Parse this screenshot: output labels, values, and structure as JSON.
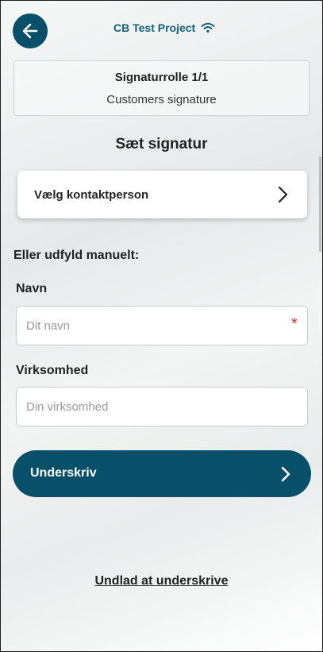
{
  "header": {
    "project_title": "CB Test Project",
    "back_icon": "arrow-left-icon",
    "status_icon": "wifi-icon"
  },
  "role": {
    "title": "Signaturrolle 1/1",
    "subtitle": "Customers signature"
  },
  "section_title": "Sæt signatur",
  "contact": {
    "label": "Vælg kontaktperson",
    "icon": "chevron-right-icon"
  },
  "manual_label": "Eller udfyld manuelt:",
  "form": {
    "name": {
      "label": "Navn",
      "placeholder": "Dit navn",
      "value": "",
      "required_marker": "*"
    },
    "company": {
      "label": "Virksomhed",
      "placeholder": "Din virksomhed",
      "value": ""
    }
  },
  "sign_button": {
    "label": "Underskriv",
    "icon": "chevron-right-icon"
  },
  "skip_link": "Undlad at underskrive",
  "colors": {
    "primary": "#08506a",
    "accent_text": "#12607a",
    "required": "#d0342c"
  }
}
